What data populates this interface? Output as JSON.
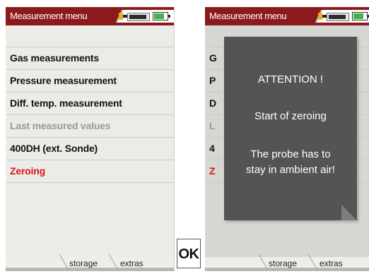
{
  "left_screen": {
    "title": "Measurement menu",
    "menu_items": [
      {
        "label": "Gas measurements",
        "state": "normal"
      },
      {
        "label": "Pressure measurement",
        "state": "normal"
      },
      {
        "label": "Diff. temp. measurement",
        "state": "normal"
      },
      {
        "label": "Last measured values",
        "state": "disabled"
      },
      {
        "label": "400DH (ext. Sonde)",
        "state": "normal"
      },
      {
        "label": "Zeroing",
        "state": "selected"
      }
    ],
    "softkeys": {
      "storage": "storage",
      "extras": "extras"
    }
  },
  "ok_key": {
    "label": "OK"
  },
  "right_screen": {
    "title": "Measurement menu",
    "menu_fragments": [
      "G",
      "P",
      "D",
      "L",
      "4",
      "Z"
    ],
    "dialog": {
      "title": "ATTENTION !",
      "line1": "Start of zeroing",
      "line2a": "The probe has to",
      "line2b": "stay in ambient air!"
    },
    "softkeys": {
      "storage": "storage",
      "extras": "extras"
    }
  },
  "icons": {
    "probe": "probe-connector-icon",
    "battery": "battery-icon"
  },
  "colors": {
    "titlebar": "#8c1a1d",
    "selected_item": "#d7141b",
    "disabled_item": "#9a9a9a",
    "dialog_bg": "#545454"
  }
}
